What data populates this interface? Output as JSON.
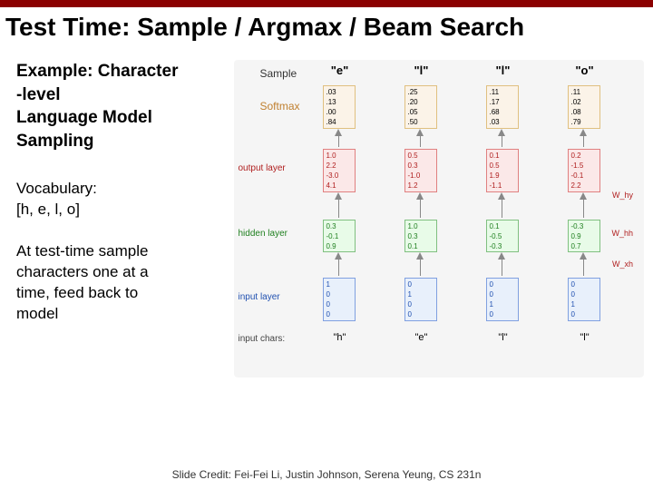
{
  "title": "Test Time: Sample / Argmax / Beam Search",
  "left": {
    "block1_l1": "Example: Character",
    "block1_l2": "-level",
    "block1_l3": "Language Model",
    "block1_l4": "Sampling",
    "block2_l1": "Vocabulary:",
    "block2_l2": "[h, e, l, o]",
    "block3_l1": "At test-time sample",
    "block3_l2": "characters one at a",
    "block3_l3": "time, feed back to",
    "block3_l4": "model"
  },
  "labels": {
    "sample": "Sample",
    "softmax": "Softmax",
    "output_layer": "output layer",
    "hidden_layer": "hidden layer",
    "input_layer": "input layer",
    "input_chars": "input chars:",
    "why": "W_hy",
    "whh": "W_hh",
    "wxh": "W_xh"
  },
  "sampled": [
    "\"e\"",
    "\"l\"",
    "\"l\"",
    "\"o\""
  ],
  "softmax": {
    "c0": [
      ".03",
      ".13",
      ".00",
      ".84"
    ],
    "c1": [
      ".25",
      ".20",
      ".05",
      ".50"
    ],
    "c2": [
      ".11",
      ".17",
      ".68",
      ".03"
    ],
    "c3": [
      ".11",
      ".02",
      ".08",
      ".79"
    ]
  },
  "output": {
    "c0": [
      "1.0",
      "2.2",
      "-3.0",
      "4.1"
    ],
    "c1": [
      "0.5",
      "0.3",
      "-1.0",
      "1.2"
    ],
    "c2": [
      "0.1",
      "0.5",
      "1.9",
      "-1.1"
    ],
    "c3": [
      "0.2",
      "-1.5",
      "-0.1",
      "2.2"
    ]
  },
  "hidden": {
    "c0": [
      "0.3",
      "-0.1",
      "0.9"
    ],
    "c1": [
      "1.0",
      "0.3",
      "0.1"
    ],
    "c2": [
      "0.1",
      "-0.5",
      "-0.3"
    ],
    "c3": [
      "-0.3",
      "0.9",
      "0.7"
    ]
  },
  "input": {
    "c0": [
      "1",
      "0",
      "0",
      "0"
    ],
    "c1": [
      "0",
      "1",
      "0",
      "0"
    ],
    "c2": [
      "0",
      "0",
      "1",
      "0"
    ],
    "c3": [
      "0",
      "0",
      "1",
      "0"
    ]
  },
  "input_chars": [
    "\"h\"",
    "\"e\"",
    "\"l\"",
    "\"l\""
  ],
  "credit": "Slide Credit: Fei-Fei Li, Justin Johnson, Serena Yeung, CS 231n",
  "chart_data": {
    "type": "table",
    "title": "Character-level RNN sampling at test time",
    "vocabulary": [
      "h",
      "e",
      "l",
      "o"
    ],
    "timesteps": [
      {
        "input_char": "h",
        "input_onehot": [
          1,
          0,
          0,
          0
        ],
        "hidden": [
          0.3,
          -0.1,
          0.9
        ],
        "output_logits": [
          1.0,
          2.2,
          -3.0,
          4.1
        ],
        "softmax": [
          0.03,
          0.13,
          0.0,
          0.84
        ],
        "sampled": "e"
      },
      {
        "input_char": "e",
        "input_onehot": [
          0,
          1,
          0,
          0
        ],
        "hidden": [
          1.0,
          0.3,
          0.1
        ],
        "output_logits": [
          0.5,
          0.3,
          -1.0,
          1.2
        ],
        "softmax": [
          0.25,
          0.2,
          0.05,
          0.5
        ],
        "sampled": "l"
      },
      {
        "input_char": "l",
        "input_onehot": [
          0,
          0,
          1,
          0
        ],
        "hidden": [
          0.1,
          -0.5,
          -0.3
        ],
        "output_logits": [
          0.1,
          0.5,
          1.9,
          -1.1
        ],
        "softmax": [
          0.11,
          0.17,
          0.68,
          0.03
        ],
        "sampled": "l"
      },
      {
        "input_char": "l",
        "input_onehot": [
          0,
          0,
          1,
          0
        ],
        "hidden": [
          -0.3,
          0.9,
          0.7
        ],
        "output_logits": [
          0.2,
          -1.5,
          -0.1,
          2.2
        ],
        "softmax": [
          0.11,
          0.02,
          0.08,
          0.79
        ],
        "sampled": "o"
      }
    ]
  }
}
